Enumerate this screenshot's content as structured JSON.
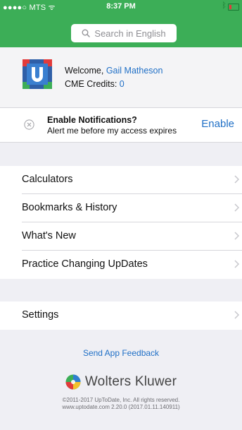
{
  "status_bar": {
    "carrier": "●●●●○ MTS ᯤ",
    "time": "8:37 PM"
  },
  "search": {
    "placeholder": "Search in English"
  },
  "welcome": {
    "prefix": "Welcome, ",
    "user_name": "Gail Matheson",
    "cme_label": "CME Credits: ",
    "cme_value": "0",
    "logo_letter": "U"
  },
  "notification": {
    "title": "Enable Notifications?",
    "subtitle": "Alert me before my access expires",
    "action": "Enable"
  },
  "menu": {
    "items": [
      {
        "label": "Calculators"
      },
      {
        "label": "Bookmarks & History"
      },
      {
        "label": "What's New"
      },
      {
        "label": "Practice Changing UpDates"
      }
    ],
    "settings": {
      "label": "Settings"
    }
  },
  "footer": {
    "feedback": "Send App Feedback",
    "brand": "Wolters Kluwer",
    "copyright": "©2011-2017 UpToDate, Inc. All rights reserved.",
    "version": "www.uptodate.com 2.20.0 (2017.01.11.140911)"
  },
  "colors": {
    "header_green": "#3cae57",
    "link_blue": "#1f6fc6",
    "background": "#efeff4"
  }
}
